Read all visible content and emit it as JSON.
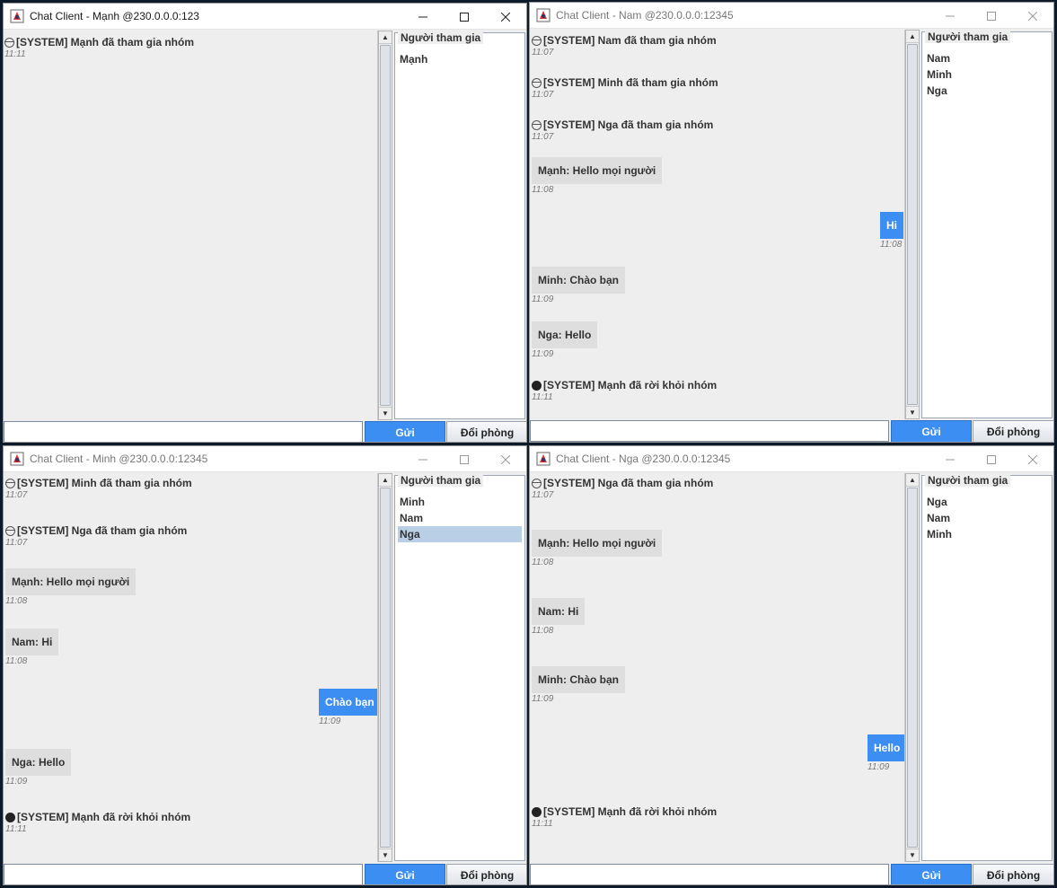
{
  "w1": {
    "title": "Chat Client - Mạnh @230.0.0.0:123",
    "messages": {
      "m1": {
        "text": "[SYSTEM] Mạnh đã tham gia nhóm",
        "time": "11:11"
      }
    },
    "participants_legend": "Người tham gia",
    "participants": [
      "Mạnh"
    ],
    "send_label": "Gửi",
    "room_label": "Đổi phòng",
    "input_value": ""
  },
  "w2": {
    "title": "Chat Client - Nam @230.0.0.0:12345",
    "messages": {
      "m1": {
        "text": "[SYSTEM] Nam đã tham gia nhóm",
        "time": "11:07"
      },
      "m2": {
        "text": "[SYSTEM] Minh đã tham gia nhóm",
        "time": "11:07"
      },
      "m3": {
        "text": "[SYSTEM] Nga đã tham gia nhóm",
        "time": "11:07"
      },
      "m4": {
        "text": "Mạnh: Hello mọi người",
        "time": "11:08"
      },
      "m5": {
        "text": "Hi",
        "time": "11:08"
      },
      "m6": {
        "text": "Minh: Chào bạn",
        "time": "11:09"
      },
      "m7": {
        "text": "Nga: Hello",
        "time": "11:09"
      },
      "m8": {
        "text": "[SYSTEM] Mạnh đã rời khỏi nhóm",
        "time": "11:11"
      }
    },
    "participants_legend": "Người tham gia",
    "participants": [
      "Nam",
      "Minh",
      "Nga"
    ],
    "send_label": "Gửi",
    "room_label": "Đổi phòng",
    "input_value": ""
  },
  "w3": {
    "title": "Chat Client - Minh @230.0.0.0:12345",
    "messages": {
      "m1": {
        "text": "[SYSTEM] Minh đã tham gia nhóm",
        "time": "11:07"
      },
      "m2": {
        "text": "[SYSTEM] Nga đã tham gia nhóm",
        "time": "11:07"
      },
      "m3": {
        "text": "Mạnh: Hello mọi người",
        "time": "11:08"
      },
      "m4": {
        "text": "Nam: Hi",
        "time": "11:08"
      },
      "m5": {
        "text": "Chào bạn",
        "time": "11:09"
      },
      "m6": {
        "text": "Nga: Hello",
        "time": "11:09"
      },
      "m7": {
        "text": "[SYSTEM] Mạnh đã rời khỏi nhóm",
        "time": "11:11"
      }
    },
    "participants_legend": "Người tham gia",
    "participants": [
      "Minh",
      "Nam",
      "Nga"
    ],
    "selected_participant": "Nga",
    "send_label": "Gửi",
    "room_label": "Đổi phòng",
    "input_value": ""
  },
  "w4": {
    "title": "Chat Client - Nga @230.0.0.0:12345",
    "messages": {
      "m1": {
        "text": "[SYSTEM] Nga đã tham gia nhóm",
        "time": "11:07"
      },
      "m2": {
        "text": "Mạnh: Hello mọi người",
        "time": "11:08"
      },
      "m3": {
        "text": "Nam: Hi",
        "time": "11:08"
      },
      "m4": {
        "text": "Minh: Chào bạn",
        "time": "11:09"
      },
      "m5": {
        "text": "Hello",
        "time": "11:09"
      },
      "m6": {
        "text": "[SYSTEM] Mạnh đã rời khỏi nhóm",
        "time": "11:11"
      }
    },
    "participants_legend": "Người tham gia",
    "participants": [
      "Nga",
      "Nam",
      "Minh"
    ],
    "send_label": "Gửi",
    "room_label": "Đổi phòng",
    "input_value": ""
  },
  "colors": {
    "accent": "#3d8ef2",
    "incoming_bubble": "#dedede",
    "selection": "#b8cfe5",
    "window_bg": "#eeeeee"
  }
}
